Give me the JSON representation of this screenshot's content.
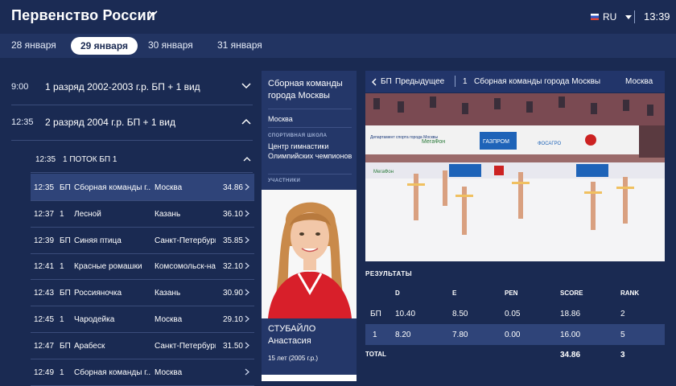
{
  "header": {
    "title": "Первенство России",
    "lang": "RU",
    "time": "13:39"
  },
  "dates": [
    "28 января",
    "29 января",
    "30 января",
    "31 января"
  ],
  "groups": [
    {
      "time": "9:00",
      "label": "1 разряд 2002-2003 г.р. БП + 1 вид"
    },
    {
      "time": "12:35",
      "label": "2 разряд 2004 г.р. БП + 1 вид"
    }
  ],
  "subgroup": {
    "time": "12:35",
    "label": "1 ПОТОК  БП  1"
  },
  "performances": [
    {
      "time": "12:35",
      "seq": "БП",
      "team": "Сборная команды г...",
      "city": "Москва",
      "score": "34.86"
    },
    {
      "time": "12:37",
      "seq": "1",
      "team": "Лесной",
      "city": "Казань",
      "score": "36.10"
    },
    {
      "time": "12:39",
      "seq": "БП",
      "team": "Синяя птица",
      "city": "Санкт-Петербург",
      "score": "35.85"
    },
    {
      "time": "12:41",
      "seq": "1",
      "team": "Красные ромашки",
      "city": "Комсомольск-на...",
      "score": "32.10"
    },
    {
      "time": "12:43",
      "seq": "БП",
      "team": "Россияночка",
      "city": "Казань",
      "score": "30.90"
    },
    {
      "time": "12:45",
      "seq": "1",
      "team": "Чародейка",
      "city": "Москва",
      "score": "29.10"
    },
    {
      "time": "12:47",
      "seq": "БП",
      "team": "Арабеск",
      "city": "Санкт-Петербург",
      "score": "31.50"
    },
    {
      "time": "12:49",
      "seq": "1",
      "team": "Сборная команды г...",
      "city": "Москва",
      "score": ""
    }
  ],
  "detail": {
    "team": "Сборная команды города Москвы",
    "city": "Москва",
    "school_caption": "СПОРТИВНАЯ ШКОЛА",
    "school": "Центр гимнастики Олимпийских чемпионов",
    "participants_caption": "УЧАСТНИКИ",
    "athlete_name": "СТУБАЙЛО Анастасия",
    "athlete_age": "15 лет (2005 г.р.)"
  },
  "nav": {
    "seq": "БП",
    "prev_label": "Предыдущее",
    "number": "1",
    "team": "Сборная команды города Москвы",
    "city": "Москва"
  },
  "results": {
    "title": "РЕЗУЛЬТАТЫ",
    "headers": [
      "D",
      "E",
      "PEN",
      "SCORE",
      "RANK"
    ],
    "rows": [
      {
        "label": "БП",
        "d": "10.40",
        "e": "8.50",
        "pen": "0.05",
        "score": "18.86",
        "rank": "2"
      },
      {
        "label": "1",
        "d": "8.20",
        "e": "7.80",
        "pen": "0.00",
        "score": "16.00",
        "rank": "5"
      }
    ],
    "total_label": "TOTAL",
    "total_score": "34.86",
    "total_rank": "3"
  },
  "video_banners": [
    "МегаФон",
    "ГАЗПРОМ",
    "ФОСАГРО",
    "Департамент спорта города Москвы"
  ]
}
